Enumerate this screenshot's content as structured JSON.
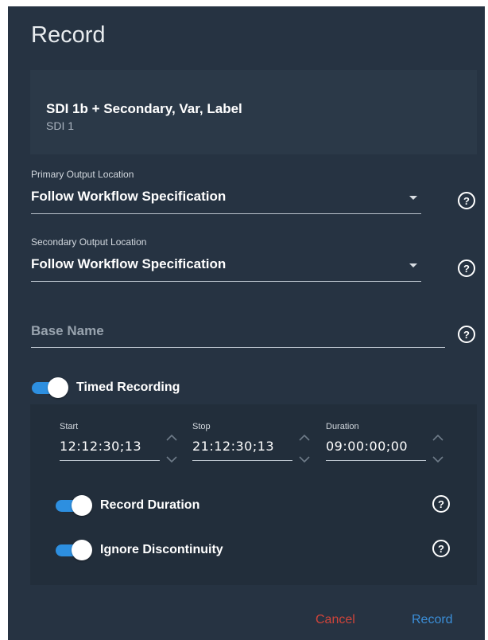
{
  "dialog": {
    "title": "Record"
  },
  "source": {
    "name": "SDI 1b + Secondary, Var, Label",
    "input": "SDI 1"
  },
  "primary_output": {
    "label": "Primary Output Location",
    "value": "Follow Workflow Specification"
  },
  "secondary_output": {
    "label": "Secondary Output Location",
    "value": "Follow Workflow Specification"
  },
  "base_name": {
    "placeholder": "Base Name",
    "value": ""
  },
  "timed_recording": {
    "label": "Timed Recording",
    "enabled": true,
    "start": {
      "label": "Start",
      "value": "12:12:30;13"
    },
    "stop": {
      "label": "Stop",
      "value": "21:12:30;13"
    },
    "duration": {
      "label": "Duration",
      "value": "09:00:00;00"
    },
    "record_duration": {
      "label": "Record Duration",
      "enabled": true
    },
    "ignore_discontinuity": {
      "label": "Ignore Discontinuity",
      "enabled": true
    }
  },
  "actions": {
    "cancel_label": "Cancel",
    "record_label": "Record"
  },
  "colors": {
    "dialog_bg": "#263342",
    "accent_blue": "#2d8fe0",
    "cancel_red": "#d0443a",
    "record_blue": "#3b8fd9"
  },
  "icons": {
    "help": "help-circle-icon",
    "dropdown": "caret-down-icon",
    "spinner_up": "chevron-up-icon",
    "spinner_down": "chevron-down-icon"
  }
}
